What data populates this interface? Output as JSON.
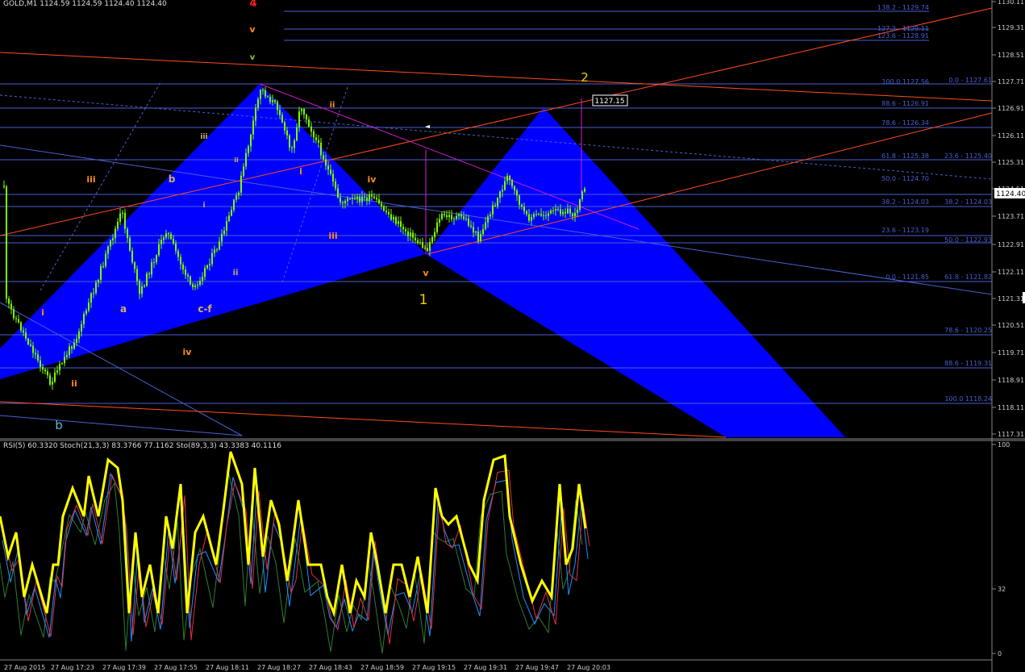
{
  "chart_header": "GOLD,M1  1124.59 1124.59 1124.40 1124.40",
  "indicator_header": "RSI(5) 60.3320  Stoch(21,3,3) 83.3766 77.1162  Sto(89,3,3) 43.3383 40.1116",
  "price_axis": [
    "1130.11",
    "1129.31",
    "1128.51",
    "1127.71",
    "1126.91",
    "1126.11",
    "1125.31",
    "1124.51",
    "1123.71",
    "1122.91",
    "1122.11",
    "1121.31",
    "1120.51",
    "1119.71",
    "1118.91",
    "1118.11",
    "1117.31"
  ],
  "current_price": "1124.40",
  "price_tag": "1127.15",
  "indicator_axis": [
    "100",
    "32",
    "0"
  ],
  "time_axis": [
    "27 Aug 2015",
    "27 Aug 17:23",
    "27 Aug 17:39",
    "27 Aug 17:55",
    "27 Aug 18:11",
    "27 Aug 18:27",
    "27 Aug 18:43",
    "27 Aug 18:59",
    "27 Aug 19:15",
    "27 Aug 19:31",
    "27 Aug 19:47",
    "27 Aug 20:03"
  ],
  "fib_labels": [
    "138.2 - 1129.74",
    "127.2 - 1129.11",
    "123.6 - 1128.91",
    "100.0 1127.56",
    "0.0 - 1127.61",
    "88.6 - 1126.91",
    "78.6 - 1126.34",
    "61.8 - 1125.38",
    "23.6 - 1125.40",
    "50.0 - 1124.70",
    "38.2 - 1124.03",
    "38.2 - 1124.03",
    "23.6 - 1123.19",
    "50.0 - 1122.93",
    "0.0 - 1121.85",
    "61.8 - 1121.82",
    "78.6 - 1120.25",
    "88.6 - 1119.31",
    "100.0 1118.24"
  ],
  "wave_labels": [
    "4",
    "v",
    "v",
    "2",
    "ii",
    "iii",
    "b",
    "iii",
    "i",
    "iv",
    "i",
    "ii",
    "i",
    "iii",
    "v",
    "1",
    "i",
    "a",
    "c-f",
    "ii",
    "iv",
    "ii",
    "b"
  ],
  "colors": {
    "background": "#000000",
    "pattern_fill": "#0000ff",
    "fib_line": "#4a5fd0",
    "candle": "#7CFC00",
    "trend_red": "#ff4d1a",
    "magenta": "#d21ed2",
    "rsi": "#ffff00"
  }
}
